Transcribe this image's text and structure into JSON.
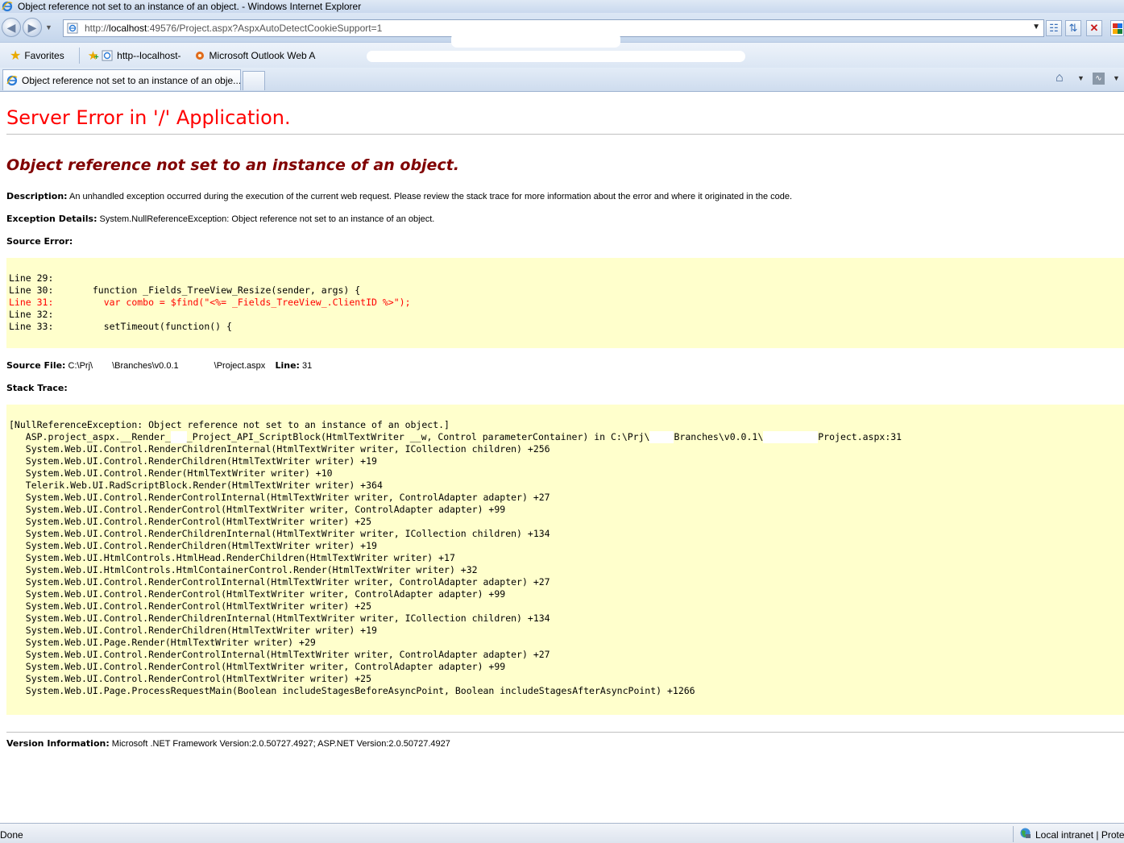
{
  "window": {
    "title": "Object reference not set to an instance of an object. - Windows Internet Explorer"
  },
  "address_bar": {
    "url_prefix": "http://",
    "url_host": "localhost",
    "url_rest": ":49576/Project.aspx?AspxAutoDetectCookieSupport=1"
  },
  "favorites_bar": {
    "favorites_label": "Favorites",
    "links": [
      {
        "label": "http--localhost-",
        "icon": "ie-page-icon"
      },
      {
        "label": "Microsoft Outlook Web A",
        "icon": "outlook-icon"
      }
    ]
  },
  "tabs": {
    "active_label": "Object reference not set to an instance of an obje..."
  },
  "page": {
    "server_error_title": "Server Error in '/' Application.",
    "error_message": "Object reference not set to an instance of an object.",
    "description_label": "Description:",
    "description_text": "An unhandled exception occurred during the execution of the current web request. Please review the stack trace for more information about the error and where it originated in the code.",
    "exception_label": "Exception Details:",
    "exception_text": "System.NullReferenceException: Object reference not set to an instance of an object.",
    "source_error_label": "Source Error:",
    "source_lines": [
      {
        "line": "Line 29:",
        "code": "",
        "highlight": false
      },
      {
        "line": "Line 30:",
        "code": "      function _Fields_TreeView_Resize(sender, args) {",
        "highlight": false
      },
      {
        "line": "Line 31:",
        "code": "        var combo = $find(\"<%= _Fields_TreeView_.ClientID %>\");",
        "highlight": true
      },
      {
        "line": "Line 32:",
        "code": "",
        "highlight": false
      },
      {
        "line": "Line 33:",
        "code": "        setTimeout(function() {",
        "highlight": false
      }
    ],
    "source_file_label": "Source File:",
    "source_file_a": "C:\\Prj\\",
    "source_file_b": "\\Branches\\v0.0.1",
    "source_file_c": "\\Project.aspx",
    "line_label": "Line:",
    "line_value": "31",
    "stack_trace_label": "Stack Trace:",
    "stack_header": "[NullReferenceException: Object reference not set to an instance of an object.]",
    "stack_first_a": "   ASP.project_aspx.__Render_",
    "stack_first_b": "_Project_API_ScriptBlock(HtmlTextWriter __w, Control parameterContainer) in C:\\Prj\\",
    "stack_first_c": "Branches\\v0.0.1\\",
    "stack_first_d": "Project.aspx:31",
    "stack_frames": [
      "   System.Web.UI.Control.RenderChildrenInternal(HtmlTextWriter writer, ICollection children) +256",
      "   System.Web.UI.Control.RenderChildren(HtmlTextWriter writer) +19",
      "   System.Web.UI.Control.Render(HtmlTextWriter writer) +10",
      "   Telerik.Web.UI.RadScriptBlock.Render(HtmlTextWriter writer) +364",
      "   System.Web.UI.Control.RenderControlInternal(HtmlTextWriter writer, ControlAdapter adapter) +27",
      "   System.Web.UI.Control.RenderControl(HtmlTextWriter writer, ControlAdapter adapter) +99",
      "   System.Web.UI.Control.RenderControl(HtmlTextWriter writer) +25",
      "   System.Web.UI.Control.RenderChildrenInternal(HtmlTextWriter writer, ICollection children) +134",
      "   System.Web.UI.Control.RenderChildren(HtmlTextWriter writer) +19",
      "   System.Web.UI.HtmlControls.HtmlHead.RenderChildren(HtmlTextWriter writer) +17",
      "   System.Web.UI.HtmlControls.HtmlContainerControl.Render(HtmlTextWriter writer) +32",
      "   System.Web.UI.Control.RenderControlInternal(HtmlTextWriter writer, ControlAdapter adapter) +27",
      "   System.Web.UI.Control.RenderControl(HtmlTextWriter writer, ControlAdapter adapter) +99",
      "   System.Web.UI.Control.RenderControl(HtmlTextWriter writer) +25",
      "   System.Web.UI.Control.RenderChildrenInternal(HtmlTextWriter writer, ICollection children) +134",
      "   System.Web.UI.Control.RenderChildren(HtmlTextWriter writer) +19",
      "   System.Web.UI.Page.Render(HtmlTextWriter writer) +29",
      "   System.Web.UI.Control.RenderControlInternal(HtmlTextWriter writer, ControlAdapter adapter) +27",
      "   System.Web.UI.Control.RenderControl(HtmlTextWriter writer, ControlAdapter adapter) +99",
      "   System.Web.UI.Control.RenderControl(HtmlTextWriter writer) +25",
      "   System.Web.UI.Page.ProcessRequestMain(Boolean includeStagesBeforeAsyncPoint, Boolean includeStagesAfterAsyncPoint) +1266"
    ],
    "version_label": "Version Information:",
    "version_text": "Microsoft .NET Framework Version:2.0.50727.4927; ASP.NET Version:2.0.50727.4927"
  },
  "status_bar": {
    "status": "Done",
    "zone": "Local intranet | Prote"
  },
  "colors": {
    "server_title": "#ff0000",
    "error_message": "#800000",
    "code_background": "#ffffcc",
    "highlight_line": "#ff0000"
  }
}
